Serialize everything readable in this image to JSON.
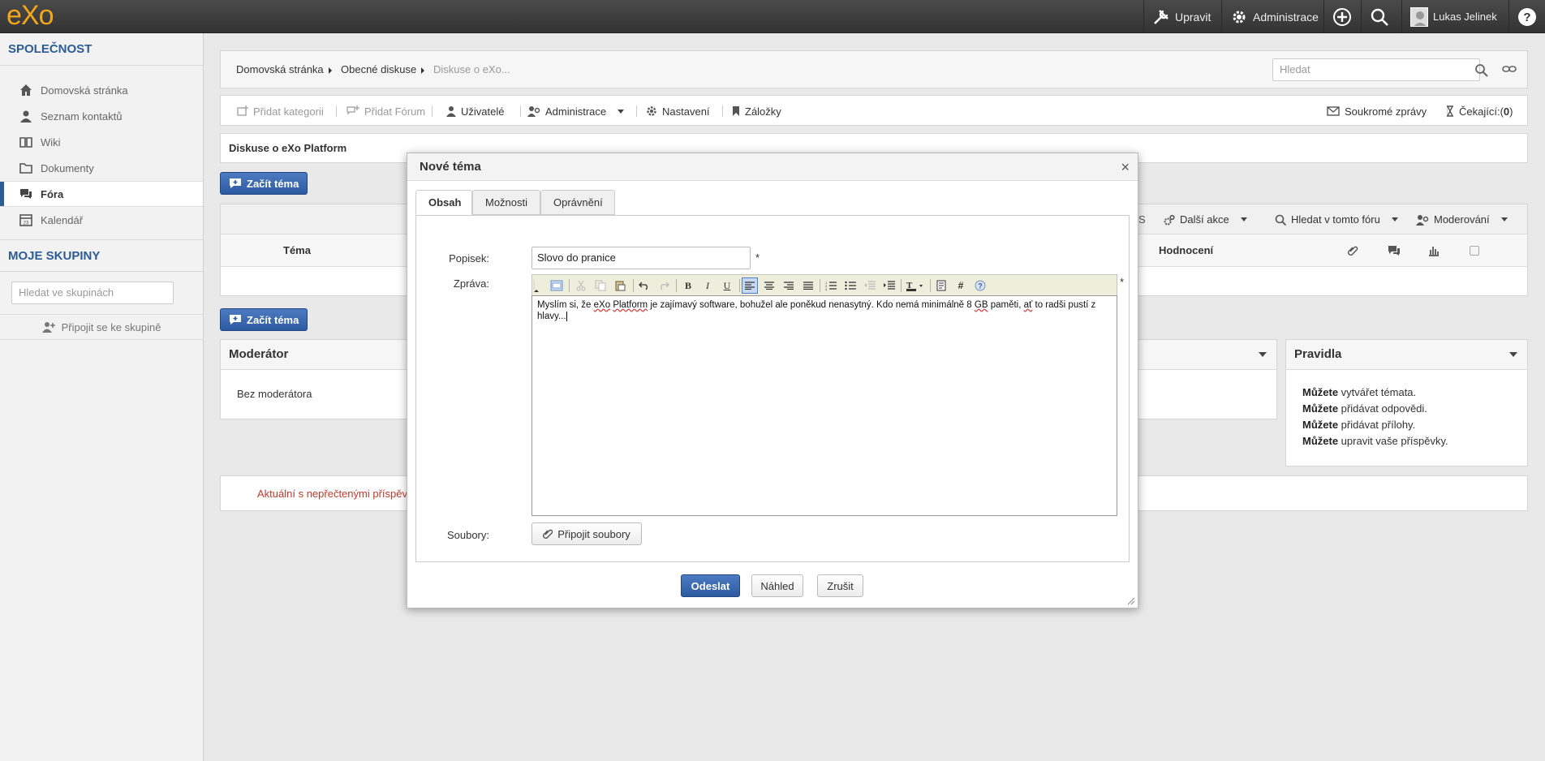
{
  "topbar": {
    "logo": "eXo",
    "edit_label": "Upravit",
    "admin_label": "Administrace",
    "user_name": "Lukas Jelinek"
  },
  "sidebar": {
    "company_title": "SPOLEČNOST",
    "items": [
      {
        "label": "Domovská stránka",
        "icon": "home-icon"
      },
      {
        "label": "Seznam kontaktů",
        "icon": "user-icon"
      },
      {
        "label": "Wiki",
        "icon": "book-icon"
      },
      {
        "label": "Dokumenty",
        "icon": "folder-icon"
      },
      {
        "label": "Fóra",
        "icon": "forum-icon"
      },
      {
        "label": "Kalendář",
        "icon": "calendar-icon"
      }
    ],
    "groups_title": "MOJE SKUPINY",
    "group_search_placeholder": "Hledat ve skupinách",
    "join_label": "Připojit se ke skupině"
  },
  "breadcrumb": {
    "items": [
      "Domovská stránka",
      "Obecné diskuse",
      "Diskuse o eXo..."
    ],
    "search_placeholder": "Hledat"
  },
  "toolbar": {
    "add_category": "Přidat kategorii",
    "add_forum": "Přidat Fórum",
    "users": "Uživatelé",
    "administration": "Administrace",
    "settings": "Nastavení",
    "bookmarks": "Záložky",
    "private_messages": "Soukromé zprávy",
    "pending_label": "Čekající:(",
    "pending_count": "0",
    "pending_close": ")"
  },
  "forum": {
    "title": "Diskuse o eXo Platform",
    "start_topic": "Začít téma",
    "more_actions": "Další akce",
    "search_forum": "Hledat v tomto fóru",
    "moderation": "Moderování",
    "col_topic": "Téma",
    "col_rating": "Hodnocení",
    "partial_s": "S",
    "moderator_title": "Moderátor",
    "no_moderator": "Bez moderátora",
    "rules_title": "Pravidla",
    "rules": [
      {
        "bold": "Můžete",
        "text": " vytvářet témata."
      },
      {
        "bold": "Můžete",
        "text": " přidávat odpovědi."
      },
      {
        "bold": "Můžete",
        "text": " přidávat přílohy."
      },
      {
        "bold": "Můžete",
        "text": " upravit vaše příspěvky."
      }
    ],
    "new_posts_note": "Aktuální s nepřečtenými příspěv"
  },
  "modal": {
    "title": "Nové téma",
    "close": "×",
    "tabs": [
      "Obsah",
      "Možnosti",
      "Oprávnění"
    ],
    "subject_label": "Popisek:",
    "subject_value": "Slovo do pranice",
    "message_label": "Zpráva:",
    "message_parts": {
      "p1": "Myslím si, že ",
      "w1": "eXo",
      "p2": " ",
      "w2": "Platform",
      "p3": " je zajímavý software, bohužel ale poněkud nenasytný. Kdo nemá minimálně 8 ",
      "w3": "GB",
      "p4": " paměti, ",
      "w4": "ať",
      "p5": " to radši pustí z hlavy..."
    },
    "files_label": "Soubory:",
    "attach_label": "Připojit soubory",
    "required_mark": "*",
    "submit": "Odeslat",
    "preview": "Náhled",
    "cancel": "Zrušit"
  },
  "editor_buttons": {
    "bold": "B",
    "italic": "I",
    "underline": "U",
    "hash": "#"
  },
  "colors": {
    "brand": "#f2a71b",
    "link_blue": "#2c5b96",
    "primary_button": "#2d5aa0",
    "alert_red": "#c0392b"
  }
}
